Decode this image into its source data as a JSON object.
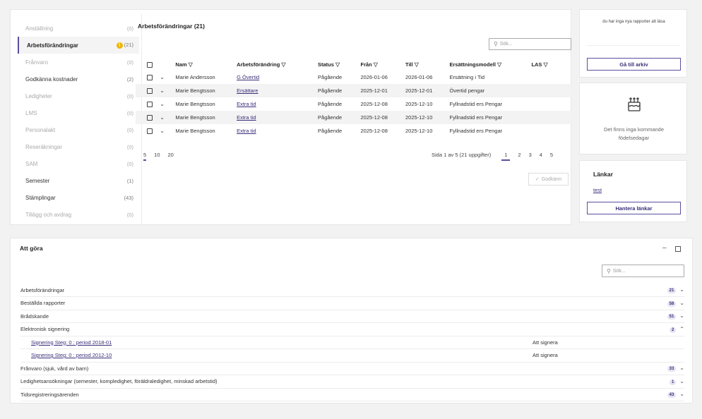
{
  "sidebar": {
    "items": [
      {
        "label": "Anställning",
        "count": "(0)",
        "dim": true
      },
      {
        "label": "Arbetsförändringar",
        "count": "(21)",
        "active": true,
        "warning": true
      },
      {
        "label": "Frånvaro",
        "count": "(0)",
        "dim": true
      },
      {
        "label": "Godkänna kostnader",
        "count": "(2)"
      },
      {
        "label": "Ledigheter",
        "count": "(0)",
        "dim": true
      },
      {
        "label": "LMS",
        "count": "(0)",
        "dim": true
      },
      {
        "label": "Personalakt",
        "count": "(0)",
        "dim": true
      },
      {
        "label": "Reseräkningar",
        "count": "(0)",
        "dim": true
      },
      {
        "label": "SAM",
        "count": "(0)",
        "dim": true
      },
      {
        "label": "Semester",
        "count": "(1)"
      },
      {
        "label": "Stämplingar",
        "count": "(43)"
      },
      {
        "label": "Tillägg och avdrag",
        "count": "(0)",
        "dim": true
      }
    ]
  },
  "main": {
    "title": "Arbetsförändringar (21)",
    "search_placeholder": "Sök...",
    "columns": [
      "Nam",
      "Arbetsförändring",
      "Status",
      "Från",
      "Till",
      "Ersättningsmodell",
      "LAS"
    ],
    "rows": [
      [
        "Marie Andersson",
        "G Övertid",
        "Pågående",
        "2026-01-06",
        "2026-01-06",
        "Ersättning i Tid",
        ""
      ],
      [
        "Marie Bengtsson",
        "Ersättare",
        "Pågående",
        "2025-12-01",
        "2025-12-01",
        "Övertid pengar",
        ""
      ],
      [
        "Marie Bengtsson",
        "Extra tid",
        "Pågående",
        "2025-12-08",
        "2025-12-10",
        "Fyllnadstid ers Pengar",
        ""
      ],
      [
        "Marie Bengtsson",
        "Extra tid",
        "Pågående",
        "2025-12-08",
        "2025-12-10",
        "Fyllnadstid ers Pengar",
        ""
      ],
      [
        "Marie Bengtsson",
        "Extra tid",
        "Pågående",
        "2025-12-08",
        "2025-12-10",
        "Fyllnadstid ers Pengar",
        ""
      ]
    ],
    "page_sizes": [
      "5",
      "10",
      "20"
    ],
    "page_info": "Sida 1 av 5 (21 uppgifter)",
    "pages": [
      "1",
      "2",
      "3",
      "4",
      "5"
    ],
    "approve_label": "Godkänn"
  },
  "reports": {
    "text": "du har inga nya rapporter att läsa",
    "button": "Gå till arkiv"
  },
  "birthdays": {
    "text": "Det finns inga kommande födelsedagar"
  },
  "links": {
    "title": "Länkar",
    "link": "test",
    "button": "Hantera länkar"
  },
  "todo": {
    "title": "Att göra",
    "search_placeholder": "Sök...",
    "rows": [
      {
        "label": "Arbetsförändringar",
        "count": "21",
        "open": false
      },
      {
        "label": "Beställda rapporter",
        "count": "58",
        "open": false
      },
      {
        "label": "Brådskande",
        "count": "51",
        "open": false
      },
      {
        "label": "Elektronisk signering",
        "count": "2",
        "open": true
      }
    ],
    "sub_rows": [
      {
        "label": "Signering Steg: 0 : period 2018-01",
        "status": "Att signera"
      },
      {
        "label": "Signering Steg: 0 : period 2012-10",
        "status": "Att signera"
      }
    ],
    "rows_after": [
      {
        "label": "Frånvaro (sjuk, vård av barn)",
        "count": "33",
        "open": false
      },
      {
        "label": "Ledighetsansökningar (semester, kompledighet, föräldraledighet, minskad arbetstid)",
        "count": "1",
        "open": false
      },
      {
        "label": "Tidsregistreringsärenden",
        "count": "43",
        "open": false
      }
    ]
  },
  "colors": {
    "accent": "#5a4fa0",
    "warning": "#f0b400"
  }
}
